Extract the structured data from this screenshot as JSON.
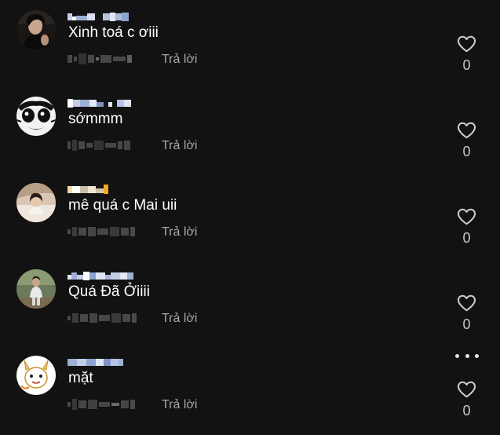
{
  "comments": [
    {
      "text": "Xinh toá c ơiii",
      "reply_label": "Trả lời",
      "like_count": "0",
      "avatar": "avatar-photo-woman-dark",
      "has_more_menu": false
    },
    {
      "text": "sớmmm",
      "reply_label": "Trả lời",
      "like_count": "0",
      "avatar": "avatar-cartoon-face",
      "has_more_menu": false
    },
    {
      "text": "mê quá c Mai uii",
      "reply_label": "Trả lời",
      "like_count": "0",
      "avatar": "avatar-photo-girl-bed",
      "has_more_menu": false
    },
    {
      "text": "Quá Đã Ởiiii",
      "reply_label": "Trả lời",
      "like_count": "0",
      "avatar": "avatar-photo-man-outdoor",
      "has_more_menu": false
    },
    {
      "text": "mặt",
      "reply_label": "Trả lời",
      "like_count": "0",
      "avatar": "avatar-cartoon-animal",
      "has_more_menu": true
    }
  ],
  "icons": {
    "like": "heart-outline-icon",
    "more": "more-horizontal-icon"
  },
  "colors": {
    "background": "#121212",
    "text_primary": "#ffffff",
    "text_secondary": "#a8a8a8",
    "count": "#c8c8c8"
  }
}
